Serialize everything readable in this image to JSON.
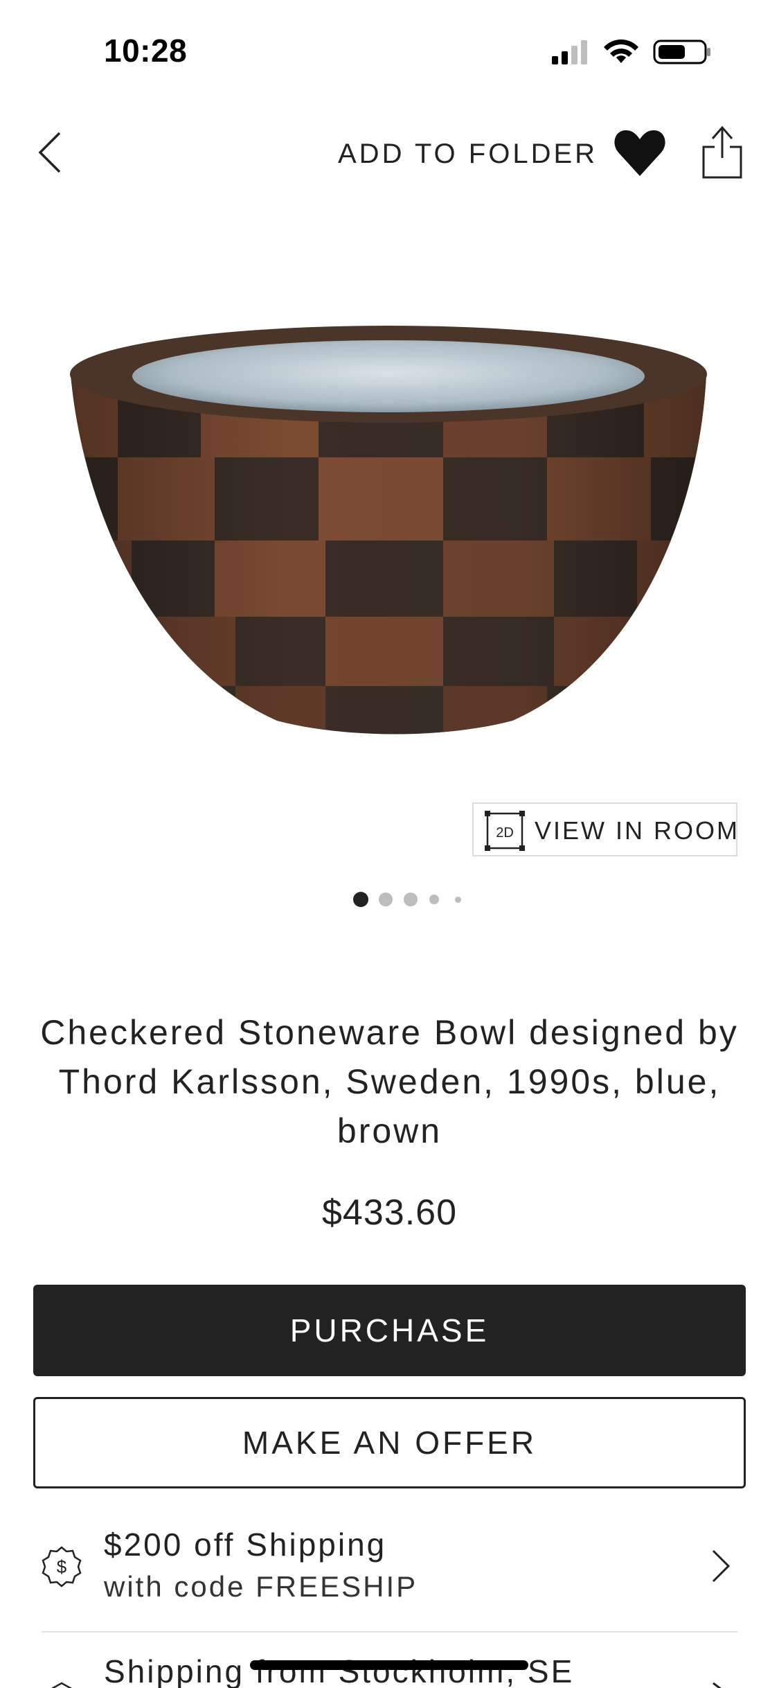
{
  "status_bar": {
    "time": "10:28",
    "icons": [
      "cellular-signal-icon",
      "wifi-icon",
      "battery-icon"
    ]
  },
  "nav": {
    "back_icon": "chevron-left-icon",
    "add_to_folder_label": "ADD TO FOLDER",
    "favorite_icon": "heart-icon",
    "share_icon": "share-icon"
  },
  "product": {
    "image_alt": "checkered-stoneware-bowl",
    "view_in_room": {
      "icon_text": "2D",
      "label": "VIEW IN ROOM"
    },
    "pager": {
      "total": 5,
      "active_index": 0
    },
    "title": "Checkered Stoneware Bowl designed by Thord Karlsson, Sweden, 1990s, blue, brown",
    "price": "$433.60"
  },
  "actions": {
    "purchase_label": "PURCHASE",
    "offer_label": "MAKE AN OFFER"
  },
  "promo": {
    "icon": "dollar-badge-icon",
    "line1": "$200 off Shipping",
    "line2": "with code FREESHIP"
  },
  "shipping": {
    "icon": "box-icon",
    "text": "Shipping from Stockholm, SE"
  },
  "colors": {
    "primary_dark": "#222222",
    "text": "#222222",
    "border_light": "#dcdcdc",
    "dot_inactive": "#bdbdbd"
  }
}
